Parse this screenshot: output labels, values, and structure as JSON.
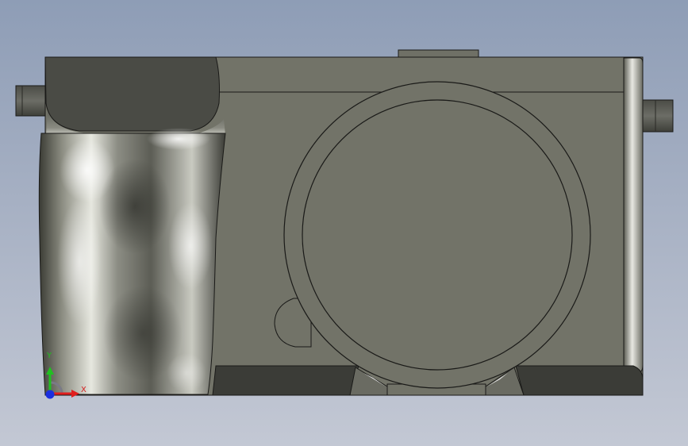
{
  "viewport": {
    "background_top": "#8e9db6",
    "background_bottom": "#c3c8d4"
  },
  "model": {
    "name": "camera-body",
    "body_color": "#727368",
    "shadow_color": "#3b3c37",
    "edge_color": "#1a1a18"
  },
  "triad": {
    "x_label": "X",
    "y_label": "Y",
    "x_color": "#e01e1e",
    "y_color": "#21c021",
    "z_color": "#1b2fe0"
  }
}
